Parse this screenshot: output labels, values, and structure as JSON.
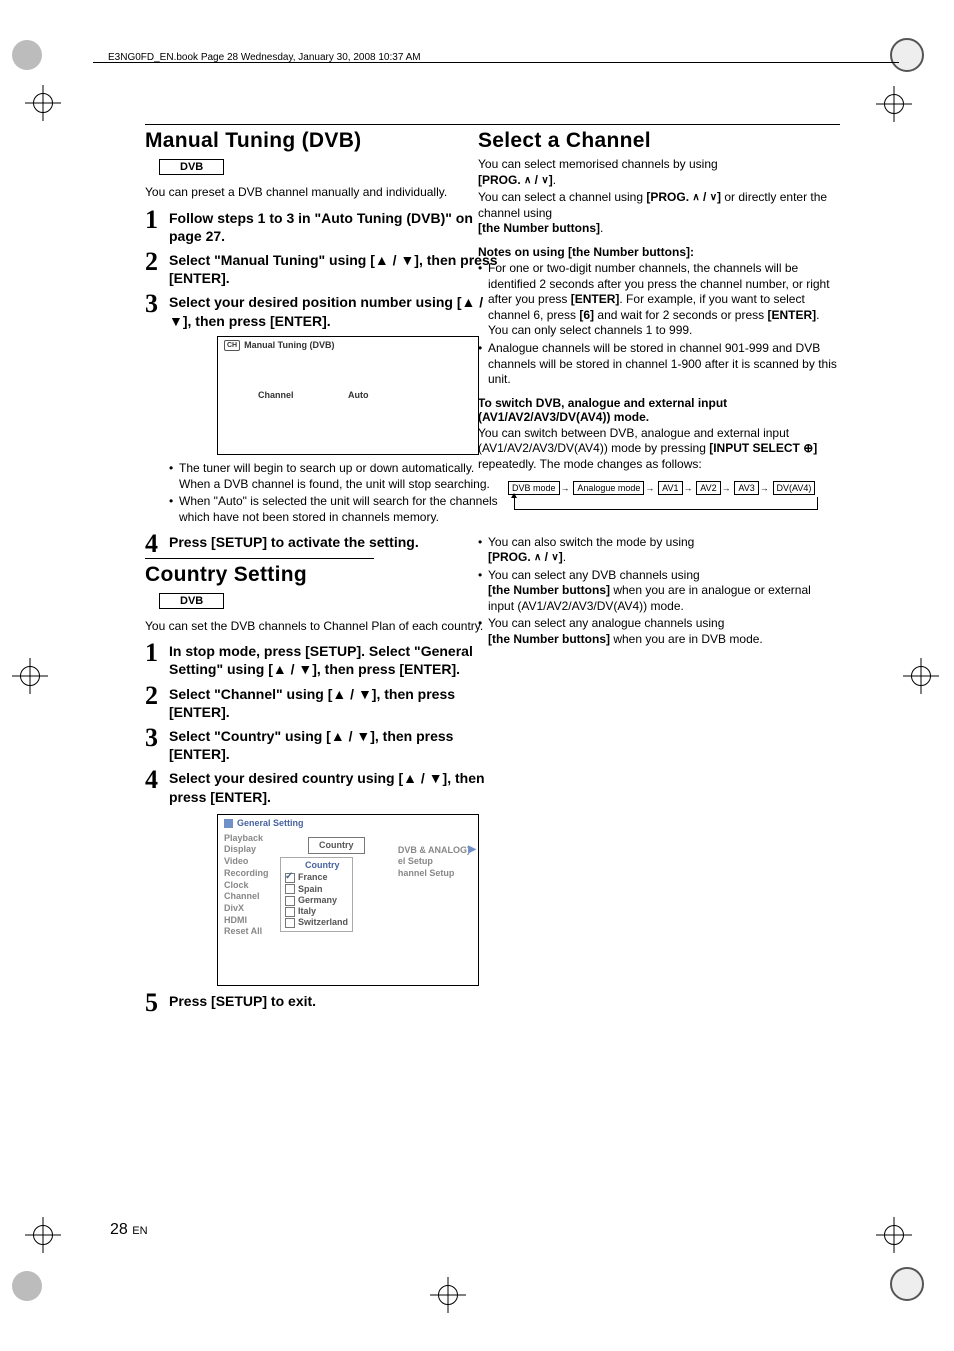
{
  "header": "E3NG0FD_EN.book  Page 28  Wednesday, January 30, 2008  10:37 AM",
  "page": {
    "num": "28",
    "lang": "EN"
  },
  "left": {
    "sec1": {
      "title": "Manual Tuning (DVB)",
      "badge": "DVB",
      "intro": "You can preset a DVB channel manually and individually.",
      "steps": [
        "Follow steps 1 to 3 in \"Auto Tuning (DVB)\" on page 27.",
        "Select \"Manual Tuning\" using [▲ / ▼], then press [ENTER].",
        "Select your desired position number using [▲ / ▼], then press [ENTER].",
        "Press [SETUP] to activate the setting."
      ],
      "osd": {
        "title": "Manual Tuning (DVB)",
        "chLabel": "Channel",
        "autoLabel": "Auto"
      },
      "notes": [
        "The tuner will begin to search up or down automatically. When a DVB channel is found, the unit will stop searching.",
        "When \"Auto\" is selected the unit will search for the channels which have not been stored in channels memory."
      ]
    },
    "sec2": {
      "title": "Country Setting",
      "badge": "DVB",
      "intro": "You can set the DVB channels to Channel Plan of each country.",
      "steps": [
        "In stop mode, press [SETUP]. Select \"General Setting\" using [▲ / ▼], then press [ENTER].",
        "Select \"Channel\" using  [▲ / ▼], then press [ENTER].",
        "Select \"Country\" using [▲ / ▼], then press [ENTER].",
        "Select your desired country using [▲ / ▼], then press [ENTER].",
        "Press [SETUP] to exit."
      ],
      "osd": {
        "title": "General Setting",
        "menu": [
          "Playback",
          "Display",
          "Video",
          "Recording",
          "Clock",
          "Channel",
          "DivX",
          "HDMI",
          "Reset All"
        ],
        "popup": "Country",
        "countryHead": "Country",
        "countries": [
          "France",
          "Spain",
          "Germany",
          "Italy",
          "Switzerland"
        ],
        "right": [
          "DVB & ANALOG)",
          "el Setup",
          "hannel Setup"
        ]
      }
    }
  },
  "right": {
    "title": "Select a Channel",
    "p1a": "You can select memorised channels by using ",
    "p1b": "[PROG. ",
    "p1c": " / ",
    "p1d": "]",
    "p1e": ".",
    "p2a": "You can select a channel using ",
    "p2b": "[PROG. ",
    "p2c": " / ",
    "p2d": "]",
    "p2e": " or directly enter the channel using",
    "p2f": "[the Number buttons]",
    "p2g": ".",
    "notesHead": "Notes on using [the Number buttons]:",
    "notes1": [
      "For one or two-digit number channels, the channels will be identified 2 seconds after you press the channel number, or right after you press [ENTER]. For example, if you want to select channel 6, press [6] and wait for 2 seconds or press [ENTER]. You can only select channels 1 to 999.",
      "Analogue channels will be stored in channel 901-999 and DVB channels will be stored in channel 1-900 after it is scanned by this unit."
    ],
    "switchHead": "To switch DVB, analogue and external input (AV1/AV2/AV3/DV(AV4)) mode.",
    "switchPara1": "You can switch between DVB, analogue and external input (AV1/AV2/AV3/DV(AV4)) mode by pressing ",
    "switchBold": "[INPUT SELECT ",
    "switchBold2": "]",
    "switchPara2": " repeatedly. The mode changes as follows:",
    "modes": [
      "DVB mode",
      "Analogue mode",
      "AV1",
      "AV2",
      "AV3",
      "DV(AV4)"
    ],
    "notes2": [
      {
        "pre": "You can also switch the mode by using ",
        "b": "[PROG. ",
        "mid": " / ",
        "b2": "]",
        "post": "."
      },
      {
        "pre": "You can select any DVB channels using ",
        "b": "[the Number buttons]",
        "post": " when you are in analogue or external input (AV1/AV2/AV3/DV(AV4)) mode."
      },
      {
        "pre": "You can select any analogue channels using ",
        "b": "[the Number buttons]",
        "post": " when you are in DVB mode."
      }
    ]
  }
}
